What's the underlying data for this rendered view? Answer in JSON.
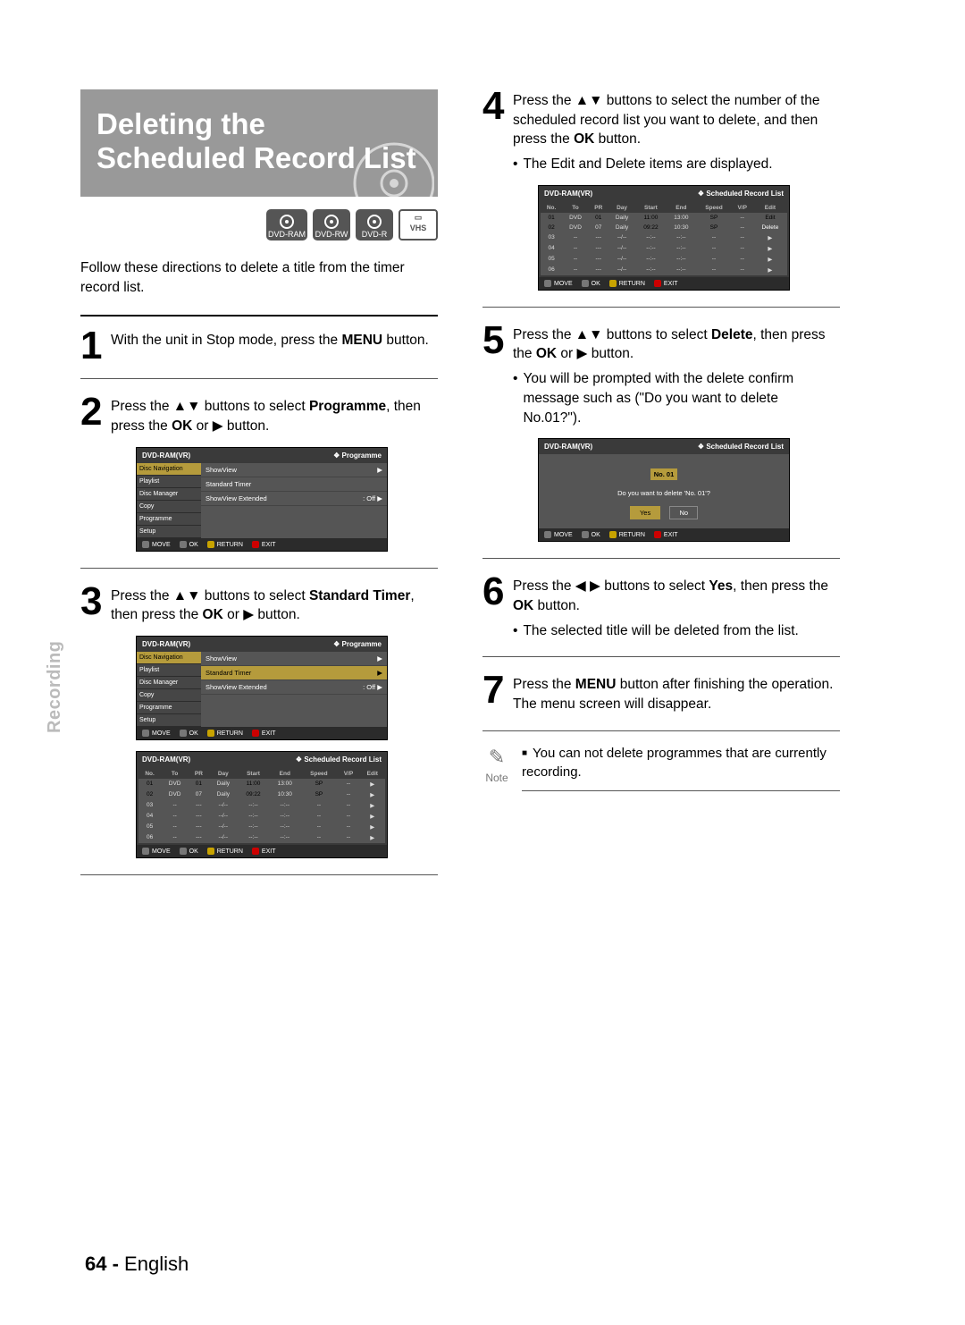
{
  "section_label": "Recording",
  "page_number": "64 -",
  "language": "English",
  "title": "Deleting the Scheduled Record List",
  "badges": {
    "ram": "DVD-RAM",
    "rw": "DVD-RW",
    "r": "DVD-R",
    "vhs": "VHS"
  },
  "intro": "Follow these directions to delete a title from the timer record list.",
  "steps": {
    "s1": {
      "num": "1",
      "text_a": "With the unit in Stop mode, press the ",
      "b1": "MENU",
      "text_b": " button."
    },
    "s2": {
      "num": "2",
      "text_a": "Press the ▲▼ buttons to select ",
      "b1": "Programme",
      "text_b": ", then press the ",
      "b2": "OK",
      "text_c": " or ▶ button."
    },
    "s3": {
      "num": "3",
      "text_a": "Press the ▲▼ buttons to select ",
      "b1": "Standard Timer",
      "text_b": ", then press the ",
      "b2": "OK",
      "text_c": " or ▶ button."
    },
    "s4": {
      "num": "4",
      "text_a": "Press the ▲▼ buttons to select the number of the scheduled record list you want to delete, and then press the ",
      "b1": "OK",
      "text_b": " button."
    },
    "s4_bullet": "The Edit and Delete items are displayed.",
    "s5": {
      "num": "5",
      "text_a": "Press the ▲▼ buttons to select ",
      "b1": "Delete",
      "text_b": ", then press the ",
      "b2": "OK",
      "text_c": " or ▶ button."
    },
    "s5_bullet": "You will be prompted with the delete confirm message such as (\"Do you want to delete No.01?\").",
    "s6": {
      "num": "6",
      "text_a": "Press the ◀ ▶ buttons to select ",
      "b1": "Yes",
      "text_b": ", then press the ",
      "b2": "OK",
      "text_c": " button."
    },
    "s6_bullet": "The selected title will be deleted from the list.",
    "s7": {
      "num": "7",
      "text_a": "Press the ",
      "b1": "MENU",
      "text_b": " button after finishing the operation. The menu screen will disappear."
    }
  },
  "note": {
    "label": "Note",
    "text": "You can not delete programmes that are currently recording."
  },
  "osd": {
    "device": "DVD-RAM(VR)",
    "section_programme": "Programme",
    "section_sched": "Scheduled Record List",
    "side": [
      "Disc Navigation",
      "Playlist",
      "Disc Manager",
      "Copy",
      "Programme",
      "Setup"
    ],
    "menu1": {
      "items": [
        {
          "label": "ShowView",
          "right": "▶"
        },
        {
          "label": "Standard Timer",
          "right": ""
        },
        {
          "label": "ShowView Extended",
          "right": ": Off    ▶"
        }
      ]
    },
    "menu2": {
      "items": [
        {
          "label": "ShowView",
          "right": "▶"
        },
        {
          "label": "Standard Timer",
          "right": "▶",
          "hl": true
        },
        {
          "label": "ShowView Extended",
          "right": ": Off    ▶"
        }
      ]
    },
    "foot": {
      "move": "MOVE",
      "ok": "OK",
      "return": "RETURN",
      "exit": "EXIT"
    },
    "sched_head": [
      "No.",
      "To",
      "PR",
      "Day",
      "Start",
      "End",
      "Speed",
      "V/P",
      "Edit"
    ],
    "sched_rows": [
      {
        "no": "01",
        "to": "DVD",
        "pr": "01",
        "day": "Daily",
        "start": "11:00",
        "end": "13:00",
        "speed": "SP",
        "vp": "--",
        "edit": "▶",
        "hl": true,
        "editLabel": "Edit"
      },
      {
        "no": "02",
        "to": "DVD",
        "pr": "07",
        "day": "Daily",
        "start": "09:22",
        "end": "10:30",
        "speed": "SP",
        "vp": "--",
        "edit": "▶",
        "delLabel": "Delete"
      },
      {
        "no": "03",
        "to": "--",
        "pr": "---",
        "day": "--/--",
        "start": "--:--",
        "end": "--:--",
        "speed": "--",
        "vp": "--",
        "edit": "▶"
      },
      {
        "no": "04",
        "to": "--",
        "pr": "---",
        "day": "--/--",
        "start": "--:--",
        "end": "--:--",
        "speed": "--",
        "vp": "--",
        "edit": "▶"
      },
      {
        "no": "05",
        "to": "--",
        "pr": "---",
        "day": "--/--",
        "start": "--:--",
        "end": "--:--",
        "speed": "--",
        "vp": "--",
        "edit": "▶"
      },
      {
        "no": "06",
        "to": "--",
        "pr": "---",
        "day": "--/--",
        "start": "--:--",
        "end": "--:--",
        "speed": "--",
        "vp": "--",
        "edit": "▶"
      }
    ],
    "confirm": {
      "title": "No. 01",
      "msg": "Do you want to delete 'No. 01'?",
      "yes": "Yes",
      "no": "No"
    }
  }
}
